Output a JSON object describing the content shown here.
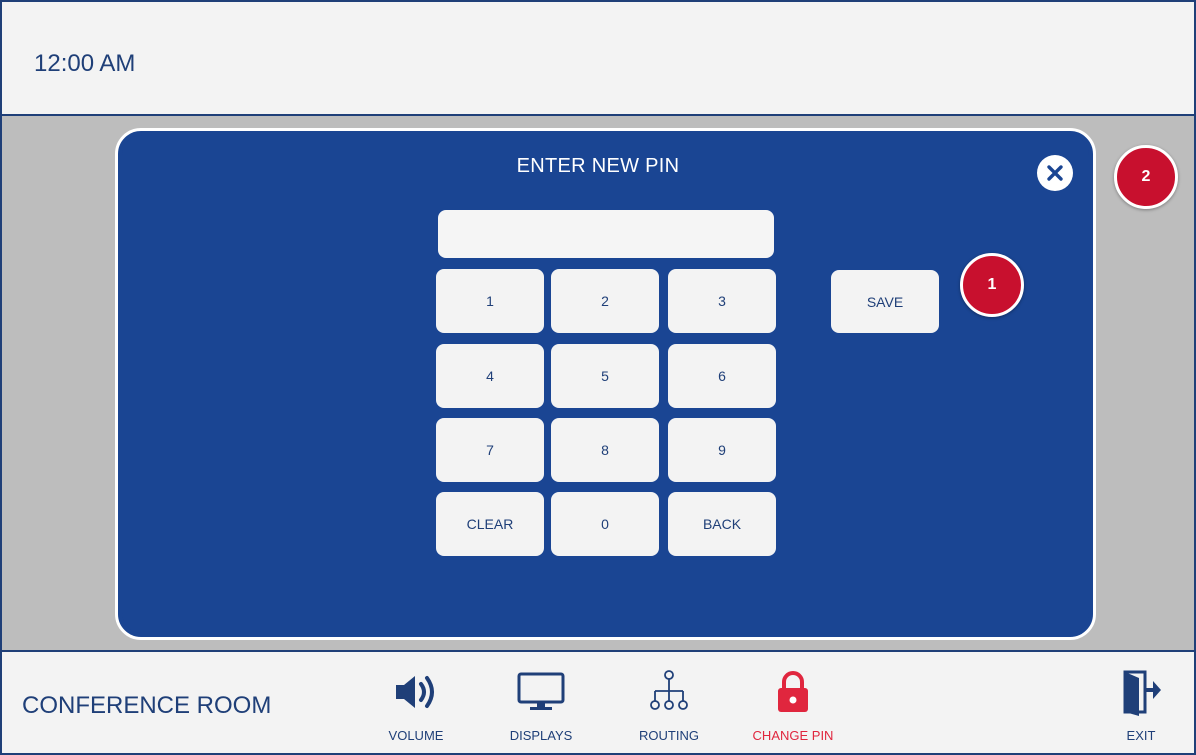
{
  "header": {
    "time": "12:00 AM"
  },
  "modal": {
    "title": "ENTER NEW PIN",
    "pin_value": "",
    "keys": [
      "1",
      "2",
      "3",
      "4",
      "5",
      "6",
      "7",
      "8",
      "9",
      "CLEAR",
      "0",
      "BACK"
    ],
    "save_label": "SAVE"
  },
  "callouts": [
    "1",
    "2"
  ],
  "footer": {
    "room_name": "CONFERENCE ROOM",
    "nav": [
      {
        "label": "VOLUME",
        "icon": "volume-icon"
      },
      {
        "label": "DISPLAYS",
        "icon": "monitor-icon"
      },
      {
        "label": "ROUTING",
        "icon": "routing-icon"
      },
      {
        "label": "CHANGE PIN",
        "icon": "lock-icon",
        "active": true
      }
    ],
    "exit_label": "EXIT"
  },
  "colors": {
    "primary": "#1a4593",
    "dark": "#1f3f78",
    "accent": "#e0263e",
    "badge": "#c8102e",
    "key_bg": "#f3f3f3",
    "content_bg": "#bdbdbd"
  }
}
